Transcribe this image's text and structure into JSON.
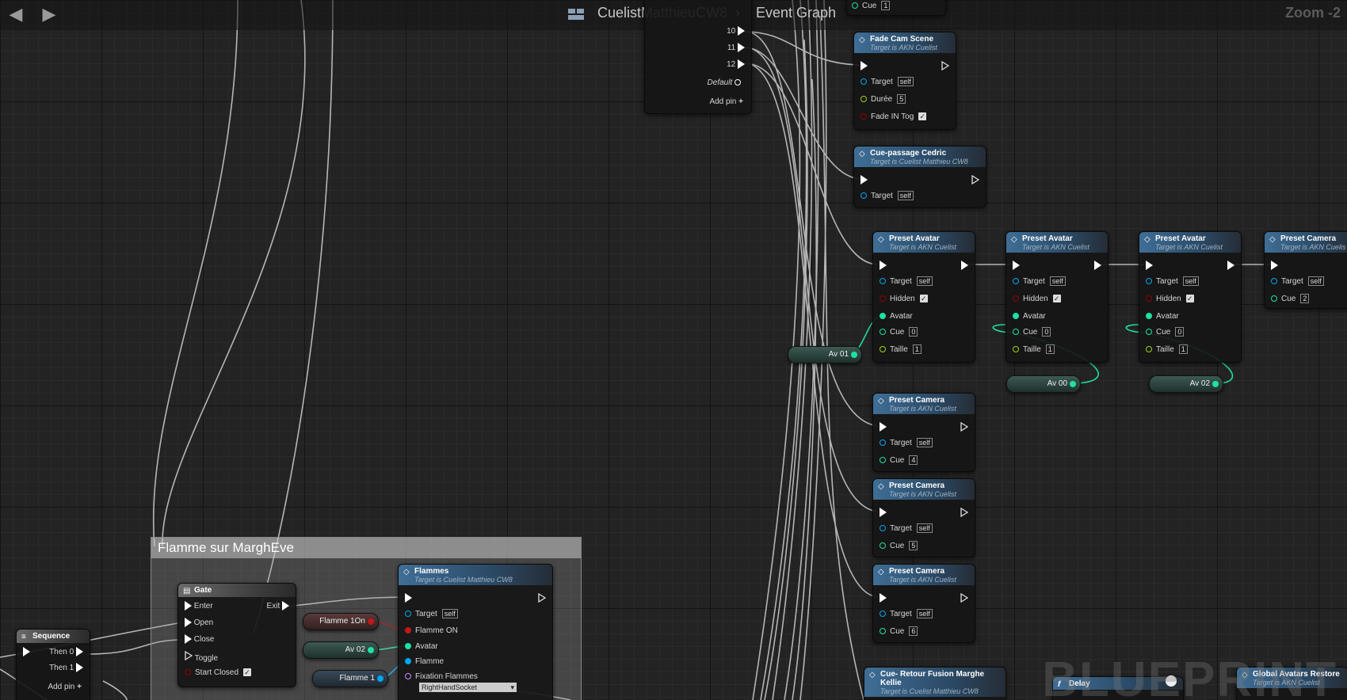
{
  "topbar": {
    "back_icon": "arrow-left-icon",
    "forward_icon": "arrow-right-icon",
    "breadcrumb": [
      "CuelistMatthieuCW8",
      "Event Graph"
    ],
    "zoom": "Zoom -2"
  },
  "watermark": "BLUEPRINT",
  "switch_node": {
    "pins": [
      "10",
      "11",
      "12"
    ],
    "default_label": "Default",
    "add_pin": "Add pin",
    "top_pin_label": "Cue",
    "top_pin_value": "1"
  },
  "fade_cam": {
    "title": "Fade Cam Scene",
    "subtitle": "Target is AKN Cuelist",
    "target_label": "Target",
    "target_value": "self",
    "duree_label": "Durée",
    "duree_value": "5",
    "fade_label": "Fade IN Tog"
  },
  "cue_passage": {
    "title": "Cue-passage Cedric",
    "subtitle": "Target is Cuelist Matthieu CW8",
    "target_label": "Target",
    "target_value": "self"
  },
  "preset_avatars": [
    {
      "title": "Preset Avatar",
      "subtitle": "Target is AKN Cuelist",
      "target": "self",
      "hidden": "Hidden",
      "avatar": "Avatar",
      "cue": "0",
      "taille": "1"
    },
    {
      "title": "Preset Avatar",
      "subtitle": "Target is AKN Cuelist",
      "target": "self",
      "hidden": "Hidden",
      "avatar": "Avatar",
      "cue": "0",
      "taille": "1"
    },
    {
      "title": "Preset Avatar",
      "subtitle": "Target is AKN Cuelist",
      "target": "self",
      "hidden": "Hidden",
      "avatar": "Avatar",
      "cue": "0",
      "taille": "1"
    }
  ],
  "preset_camera_right": {
    "title": "Preset Camera",
    "subtitle": "Target is AKN Cuelis",
    "target": "self",
    "cue": "2"
  },
  "preset_cameras": [
    {
      "title": "Preset Camera",
      "subtitle": "Target is AKN Cuelist",
      "target": "self",
      "cue": "4"
    },
    {
      "title": "Preset Camera",
      "subtitle": "Target is AKN Cuelist",
      "target": "self",
      "cue": "5"
    },
    {
      "title": "Preset Camera",
      "subtitle": "Target is AKN Cuelist",
      "target": "self",
      "cue": "6"
    }
  ],
  "labels": {
    "target": "Target",
    "cue": "Cue",
    "taille": "Taille"
  },
  "variables": {
    "av01": "Av 01",
    "av00": "Av 00",
    "av02_right": "Av 02",
    "flamme10n": "Flamme 1On",
    "av02_left": "Av 02",
    "flamme1": "Flamme 1"
  },
  "comment_title": "Flamme sur MarghEve",
  "gate": {
    "title": "Gate",
    "enter": "Enter",
    "open": "Open",
    "close": "Close",
    "toggle": "Toggle",
    "start_closed": "Start Closed",
    "exit": "Exit"
  },
  "flammes": {
    "title": "Flammes",
    "subtitle": "Target is Cuelist Matthieu CW8",
    "target": "Target",
    "target_value": "self",
    "flamme_on": "Flamme ON",
    "avatar": "Avatar",
    "flamme": "Flamme",
    "fixation": "Fixation Flammes",
    "socket": "RightHandSocket"
  },
  "sequence": {
    "title": "Sequence",
    "then0": "Then 0",
    "then1": "Then 1",
    "add_pin": "Add pin"
  },
  "bottom_nodes": {
    "retour": {
      "title": "Cue- Retour Fusion Marghe Kellie",
      "subtitle": "Target is Cuelist Matthieu CW8"
    },
    "delay": {
      "title": "Delay"
    },
    "global": {
      "title": "Global Avatars Restore",
      "subtitle": "Target is AKN Cuelist"
    }
  },
  "colors": {
    "exec": "#ffffff",
    "object": "#00a7f0",
    "int": "#1fe0a4",
    "bool": "#940000",
    "struct": "#1fb89a",
    "wire": "#c8c8c8"
  }
}
